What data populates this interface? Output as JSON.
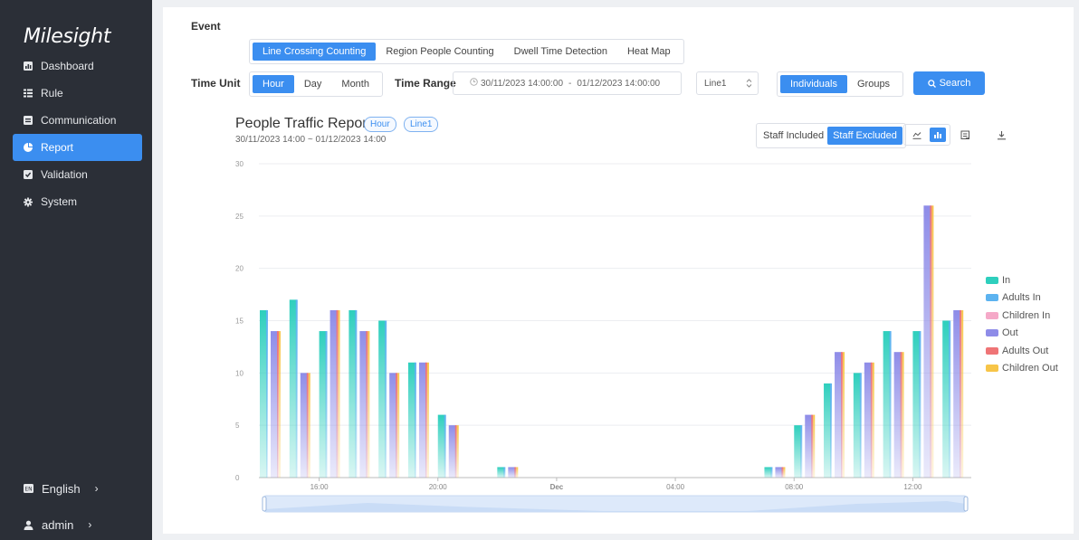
{
  "sidebar": {
    "logo": "Milesight",
    "items": [
      {
        "label": "Dashboard",
        "icon": "dashboard-icon"
      },
      {
        "label": "Rule",
        "icon": "rule-icon"
      },
      {
        "label": "Communication",
        "icon": "communication-icon"
      },
      {
        "label": "Report",
        "icon": "report-icon",
        "active": true
      },
      {
        "label": "Validation",
        "icon": "validation-icon"
      },
      {
        "label": "System",
        "icon": "gear-icon"
      }
    ],
    "language": "English",
    "user": "admin",
    "chevron": "›"
  },
  "filters": {
    "event_label": "Event",
    "events": [
      "Line Crossing Counting",
      "Region People Counting",
      "Dwell Time Detection",
      "Heat Map"
    ],
    "time_unit_label": "Time Unit",
    "time_units": [
      "Hour",
      "Day",
      "Month"
    ],
    "time_range_label": "Time Range",
    "time_range_start": "30/11/2023 14:00:00",
    "time_range_sep": "-",
    "time_range_end": "01/12/2023 14:00:00",
    "line_select": "Line1",
    "modes": [
      "Individuals",
      "Groups"
    ],
    "search_label": "Search"
  },
  "report": {
    "title": "People Traffic Report",
    "tag_unit": "Hour",
    "tag_line": "Line1",
    "range": "30/11/2023 14:00 ~ 01/12/2023 14:00",
    "staff_options": [
      "Staff Included",
      "Staff Excluded"
    ]
  },
  "colors": {
    "accent": "#3b8ef0",
    "sidebar_bg": "#2b2f37"
  },
  "chart_data": {
    "type": "bar",
    "title": "",
    "ylim": [
      0,
      30
    ],
    "yticks": [
      0,
      5,
      10,
      15,
      20,
      25,
      30
    ],
    "grid": true,
    "legend_position": "right",
    "xtick_labels": [
      "16:00",
      "20:00",
      "Dec",
      "04:00",
      "08:00",
      "12:00"
    ],
    "series": [
      {
        "name": "In",
        "color": "#2ecfbd",
        "values": [
          16,
          17,
          14,
          16,
          15,
          11,
          6,
          0,
          1,
          0,
          0,
          0,
          0,
          0,
          0,
          0,
          0,
          1,
          5,
          9,
          10,
          14,
          14,
          15
        ]
      },
      {
        "name": "Adults In",
        "color": "#5cb3f0",
        "values": [
          16,
          17,
          14,
          16,
          15,
          11,
          6,
          0,
          1,
          0,
          0,
          0,
          0,
          0,
          0,
          0,
          0,
          1,
          5,
          9,
          10,
          14,
          14,
          15
        ]
      },
      {
        "name": "Children In",
        "color": "#f5a9c8",
        "values": [
          0,
          0,
          0,
          0,
          0,
          0,
          0,
          0,
          0,
          0,
          0,
          0,
          0,
          0,
          0,
          0,
          0,
          0,
          0,
          0,
          0,
          0,
          0,
          0
        ]
      },
      {
        "name": "Out",
        "color": "#8e8ce8",
        "values": [
          14,
          10,
          16,
          14,
          10,
          11,
          5,
          0,
          1,
          0,
          0,
          0,
          0,
          0,
          0,
          0,
          0,
          1,
          6,
          12,
          11,
          12,
          26,
          16
        ]
      },
      {
        "name": "Adults Out",
        "color": "#ef7476",
        "values": [
          14,
          10,
          16,
          14,
          10,
          11,
          5,
          0,
          1,
          0,
          0,
          0,
          0,
          0,
          0,
          0,
          0,
          1,
          6,
          12,
          11,
          12,
          26,
          16
        ]
      },
      {
        "name": "Children Out",
        "color": "#f7c548",
        "values": [
          14,
          10,
          16,
          14,
          10,
          11,
          5,
          0,
          1,
          0,
          0,
          0,
          0,
          0,
          0,
          0,
          0,
          1,
          6,
          12,
          11,
          12,
          26,
          16
        ]
      }
    ]
  }
}
